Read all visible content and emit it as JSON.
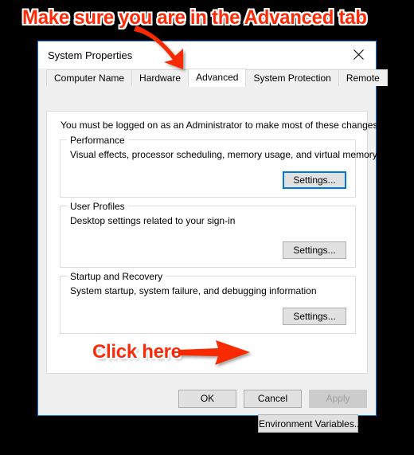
{
  "annotations": {
    "top_text": "Make sure you are in the Advanced tab",
    "bottom_text": "Click here",
    "color": "#fb2b09",
    "outline_color": "#ffffff",
    "top_arrow_icon": "arrow-down-right-icon",
    "bottom_arrow_icon": "arrow-right-icon"
  },
  "dialog": {
    "title": "System Properties",
    "close_icon": "close-icon",
    "accent_color": "#0078d7",
    "tabs": [
      {
        "label": "Computer Name",
        "active": false
      },
      {
        "label": "Hardware",
        "active": false
      },
      {
        "label": "Advanced",
        "active": true
      },
      {
        "label": "System Protection",
        "active": false
      },
      {
        "label": "Remote",
        "active": false
      }
    ],
    "page": {
      "admin_note": "You must be logged on as an Administrator to make most of these changes.",
      "groups": [
        {
          "legend": "Performance",
          "description": "Visual effects, processor scheduling, memory usage, and virtual memory",
          "button_label": "Settings...",
          "focused": true
        },
        {
          "legend": "User Profiles",
          "description": "Desktop settings related to your sign-in",
          "button_label": "Settings...",
          "focused": false
        },
        {
          "legend": "Startup and Recovery",
          "description": "System startup, system failure, and debugging information",
          "button_label": "Settings...",
          "focused": false
        }
      ],
      "environment_variables_label": "Environment Variables..."
    },
    "footer": {
      "ok_label": "OK",
      "cancel_label": "Cancel",
      "apply_label": "Apply",
      "apply_disabled": true
    }
  }
}
